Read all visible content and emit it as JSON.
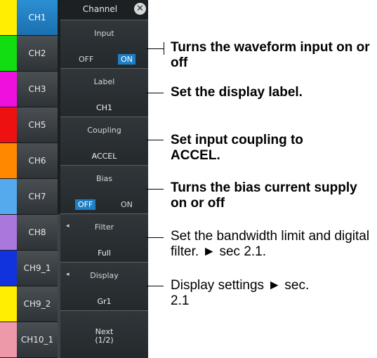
{
  "channels": [
    {
      "label": "CH1",
      "color": "#ffee00",
      "active": true
    },
    {
      "label": "CH2",
      "color": "#11dd11",
      "active": false
    },
    {
      "label": "CH3",
      "color": "#ee11dd",
      "active": false
    },
    {
      "label": "CH5",
      "color": "#ee1111",
      "active": false
    },
    {
      "label": "CH6",
      "color": "#ff8800",
      "active": false
    },
    {
      "label": "CH7",
      "color": "#55aaee",
      "active": false
    },
    {
      "label": "CH8",
      "color": "#aa77dd",
      "active": false
    },
    {
      "label": "CH9_1",
      "color": "#1133dd",
      "active": false
    },
    {
      "label": "CH9_2",
      "color": "#ffee00",
      "active": false
    },
    {
      "label": "CH10_1",
      "color": "#ee99aa",
      "active": false
    }
  ],
  "menu": {
    "title": "Channel",
    "close_icon": "close-circle-icon",
    "input": {
      "title": "Input",
      "off": "OFF",
      "on": "ON",
      "selected": "ON"
    },
    "label": {
      "title": "Label",
      "value": "CH1"
    },
    "coupling": {
      "title": "Coupling",
      "value": "ACCEL"
    },
    "bias": {
      "title": "Bias",
      "off": "OFF",
      "on": "ON",
      "selected": "OFF"
    },
    "filter": {
      "title": "Filter",
      "value": "Full",
      "arrow": "◂"
    },
    "display": {
      "title": "Display",
      "value": "Gr1",
      "arrow": "◂"
    },
    "next": {
      "line1": "Next",
      "line2": "(1/2)"
    }
  },
  "callouts": {
    "input": "Turns the waveform input on or off",
    "label": "Set the display label.",
    "coupling": "Set input coupling to ACCEL.",
    "bias": "Turns the bias current supply on or off",
    "filter": "Set the bandwidth limit and digital filter. ► sec 2.1.",
    "display": "Display settings ► sec. 2.1"
  }
}
